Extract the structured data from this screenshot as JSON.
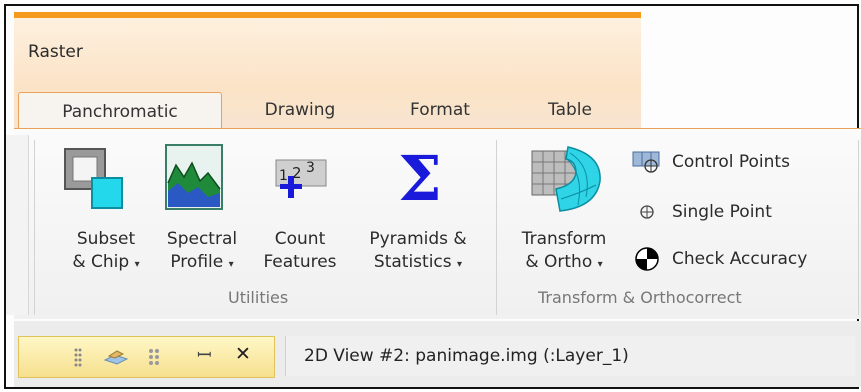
{
  "ribbon": {
    "contextual_group_title": "Raster",
    "tabs": [
      {
        "label": "Panchromatic",
        "selected": true
      },
      {
        "label": "Drawing"
      },
      {
        "label": "Format"
      },
      {
        "label": "Table"
      }
    ],
    "groups": {
      "utilities": {
        "label": "Utilities",
        "buttons": {
          "subset": {
            "line1": "Subset",
            "line2": "& Chip",
            "icon": "subset-chip-icon"
          },
          "spectral": {
            "line1": "Spectral",
            "line2": "Profile",
            "icon": "spectral-profile-icon"
          },
          "count": {
            "line1": "Count",
            "line2": "Features",
            "icon": "count-features-icon"
          },
          "pyramids": {
            "line1": "Pyramids &",
            "line2": "Statistics",
            "icon": "sigma-icon"
          }
        }
      },
      "transform": {
        "label": "Transform & Orthocorrect",
        "buttons": {
          "transform": {
            "line1": "Transform",
            "line2": "& Ortho",
            "icon": "transform-grid-icon"
          },
          "control_points": {
            "label": "Control Points",
            "icon": "control-points-icon"
          },
          "single_point": {
            "label": "Single Point",
            "icon": "crosshair-icon"
          },
          "check_accuracy": {
            "label": "Check Accuracy",
            "icon": "check-accuracy-icon"
          }
        }
      }
    }
  },
  "panel": {
    "icons": [
      "grip-icon",
      "layers-icon",
      "options-icon",
      "pin-icon",
      "close-icon"
    ],
    "pin_glyph": "ꟷ",
    "close_glyph": "✕"
  },
  "view_tab": {
    "title": "2D View #2: panimage.img (:Layer_1)"
  },
  "caret_glyph": "▾",
  "colors": {
    "contextual_accent": "#f59a1d",
    "sigma_blue": "#1a1adb",
    "cyan": "#1fd6e8"
  }
}
